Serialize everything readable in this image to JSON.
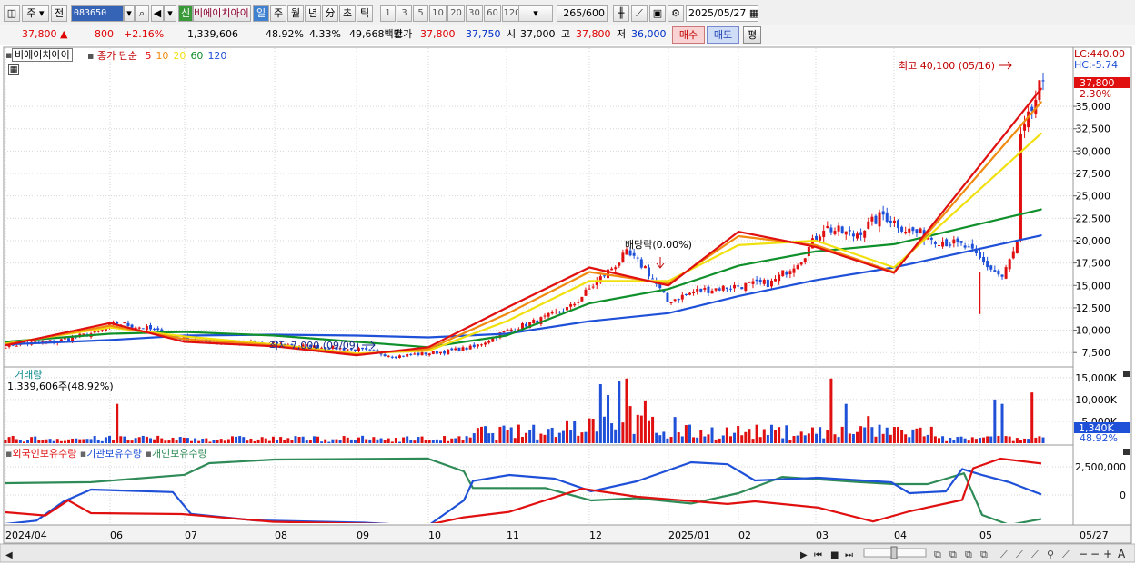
{
  "toolbar": {
    "market_type": "주",
    "prev_label": "전",
    "stock_code": "083650",
    "credit_badge": "신",
    "stock_name": "비에이치아이",
    "periods": [
      "일",
      "주",
      "월",
      "년",
      "分",
      "초",
      "틱"
    ],
    "active_period": "일",
    "intervals": [
      "1",
      "3",
      "5",
      "10",
      "20",
      "30",
      "60",
      "120"
    ],
    "view_count": "265",
    "view_max": "/600",
    "date": "2025/05/27"
  },
  "quote": {
    "price": "37,800",
    "up_arrow": "▲",
    "change": "800",
    "change_pct": "+2.16%",
    "volume": "1,339,606",
    "vol_ratio": "48.92%",
    "turnover": "4.33%",
    "amount": "49,668백만",
    "hoga_label": "호가",
    "ask": "37,800",
    "bid": "37,750",
    "open_label": "시",
    "open": "37,000",
    "high_label": "고",
    "high": "37,800",
    "low_label": "저",
    "low": "36,000",
    "buy_label": "매수",
    "sell_label": "매도",
    "avg_label": "평"
  },
  "price_panel": {
    "stock_box": "비에이치아이",
    "ma_legend_title": "종가 단순",
    "ma_legend": [
      {
        "period": "5",
        "color": "#e01010"
      },
      {
        "period": "10",
        "color": "#f08a10"
      },
      {
        "period": "20",
        "color": "#f0e010"
      },
      {
        "period": "60",
        "color": "#10902a"
      },
      {
        "period": "120",
        "color": "#1f50d8"
      }
    ],
    "lc": "LC:440.00",
    "hc": "HC:-5.74",
    "last_price": "37,800",
    "last_pct": "2.30%",
    "high_annotation": "최고 40,100 (05/16)",
    "low_annotation": "최저 7,000 (09/09)",
    "dividend_annotation": "배당락(0.00%)",
    "y_ticks": [
      "35,000",
      "32,500",
      "30,000",
      "27,500",
      "25,000",
      "22,500",
      "20,000",
      "17,500",
      "15,000",
      "12,500",
      "10,000",
      "7,500"
    ]
  },
  "volume_panel": {
    "title": "거래량",
    "value": "1,339,606주(48.92%)",
    "y_ticks": [
      "15,000K",
      "10,000K",
      "5,000K"
    ],
    "last_volume": "1,340K",
    "last_pct": "48.92%"
  },
  "holder_panel": {
    "legend": [
      {
        "label": "외국인보유수량",
        "color": "#e01010"
      },
      {
        "label": "기관보유수량",
        "color": "#1f50d8"
      },
      {
        "label": "개인보유수량",
        "color": "#2e8b57"
      }
    ],
    "y_ticks": [
      "2,500,000",
      "0"
    ]
  },
  "x_axis": {
    "labels": [
      "2024/04",
      "06",
      "07",
      "08",
      "09",
      "10",
      "11",
      "12",
      "2025/01",
      "02",
      "03",
      "04",
      "05",
      "05/27"
    ]
  },
  "chart_data": {
    "type": "line",
    "x": [
      "2024/04",
      "06",
      "07",
      "08",
      "09",
      "10",
      "11",
      "12",
      "2025/01",
      "02",
      "03",
      "04",
      "05"
    ],
    "ylim": [
      6000,
      41500
    ],
    "series": [
      {
        "name": "5",
        "values": [
          8300,
          10800,
          8700,
          8200,
          7200,
          8100,
          12500,
          17000,
          15000,
          21000,
          19300,
          16400,
          37000
        ]
      },
      {
        "name": "10",
        "values": [
          8400,
          10500,
          9000,
          8300,
          7300,
          7900,
          11800,
          16500,
          15200,
          20500,
          19500,
          16500,
          35500
        ]
      },
      {
        "name": "20",
        "values": [
          8500,
          10300,
          9300,
          8400,
          7400,
          7700,
          11000,
          15500,
          15500,
          19500,
          20000,
          17000,
          32000
        ]
      },
      {
        "name": "60",
        "values": [
          8700,
          9600,
          9800,
          9400,
          8700,
          8100,
          9400,
          13000,
          14600,
          17200,
          18800,
          19600,
          23500
        ]
      },
      {
        "name": "120",
        "values": [
          8400,
          8900,
          9400,
          9500,
          9400,
          9200,
          9600,
          11000,
          11900,
          13800,
          15600,
          17000,
          20600
        ]
      }
    ]
  }
}
